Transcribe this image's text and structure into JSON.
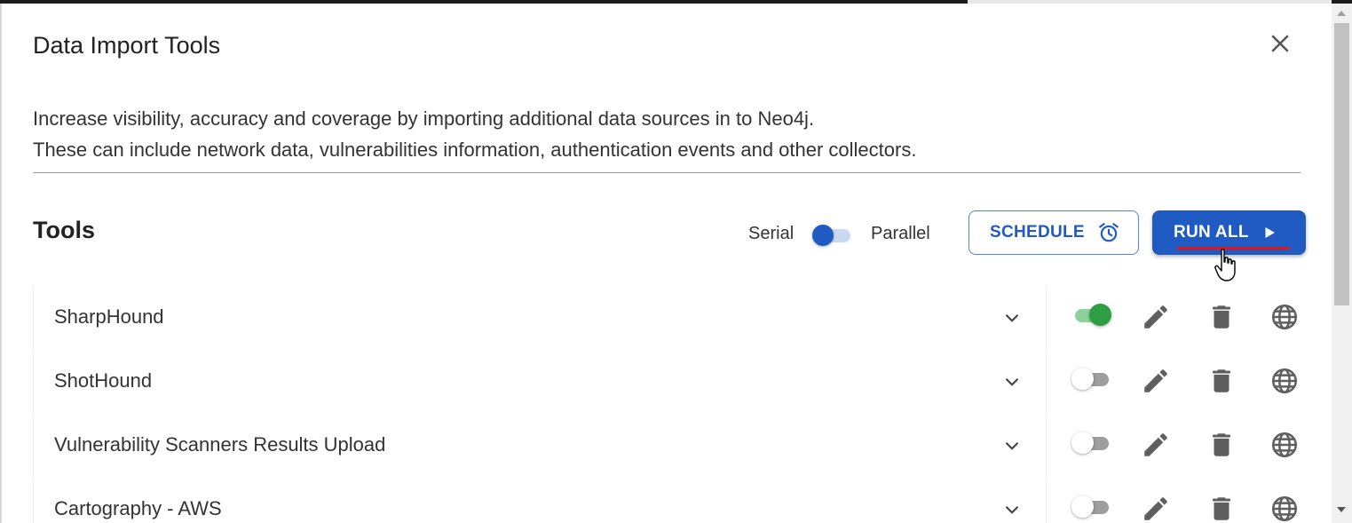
{
  "dialog": {
    "title": "Data Import Tools",
    "description_line1": "Increase visibility, accuracy and coverage by importing additional data sources in to Neo4j.",
    "description_line2": "These can include network data, vulnerabilities information, authentication events and other collectors."
  },
  "tools_section": {
    "heading": "Tools",
    "mode_left_label": "Serial",
    "mode_right_label": "Parallel",
    "mode_selected": "Serial",
    "schedule_label": "SCHEDULE",
    "run_all_label": "RUN ALL"
  },
  "tools": [
    {
      "name": "SharpHound",
      "enabled": true
    },
    {
      "name": "ShotHound",
      "enabled": false
    },
    {
      "name": "Vulnerability Scanners Results Upload",
      "enabled": false
    },
    {
      "name": "Cartography - AWS",
      "enabled": false
    }
  ],
  "icons": {
    "close": "close-icon",
    "schedule": "alarm-clock-icon",
    "run": "play-icon",
    "expand": "chevron-down-icon",
    "edit": "pencil-icon",
    "delete": "trash-icon",
    "web": "globe-icon"
  },
  "colors": {
    "primary": "#1f5bc2",
    "toggle_on": "#2e9e43",
    "highlight_underline": "#e0141a"
  }
}
